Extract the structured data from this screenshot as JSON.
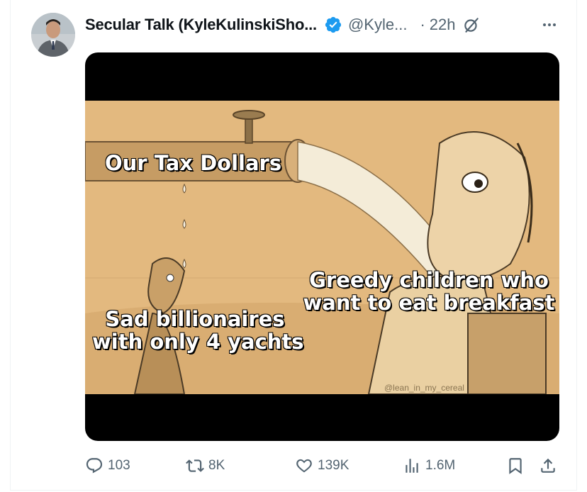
{
  "tweet": {
    "author_name": "Secular Talk (KyleKulinskiSho...",
    "handle": "@Kyle...",
    "separator": "·",
    "time": "22h",
    "icons": {
      "avatar": "avatar",
      "verified": "verified-badge-icon",
      "grok": "grok-icon",
      "more": "more-icon"
    }
  },
  "meme": {
    "caption_tax": "Our Tax Dollars",
    "caption_greedy_line1": "Greedy children who",
    "caption_greedy_line2": "want to eat breakfast",
    "caption_sad_line1": "Sad billionaires",
    "caption_sad_line2": "with only 4 yachts",
    "watermark": "@lean_in_my_cereal"
  },
  "actions": {
    "replies": "103",
    "reposts": "8K",
    "likes": "139K",
    "views": "1.6M"
  },
  "colors": {
    "text_primary": "#0f1419",
    "text_secondary": "#536471",
    "verified_blue": "#1d9bf0",
    "meme_background": "#e3b97f"
  }
}
